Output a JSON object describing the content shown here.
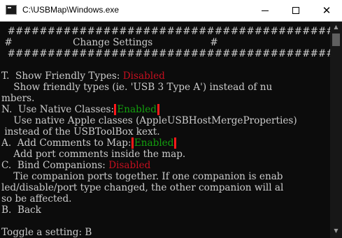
{
  "window": {
    "title": "C:\\USBMap\\Windows.exe",
    "minimize_glyph": "",
    "close_glyph": "✕"
  },
  "console": {
    "lines": [
      "  #######################################################",
      " #                    Change Settings                   #",
      "  #######################################################",
      "",
      "T.  Show Friendly Types: ",
      "    Show friendly types (ie. 'USB 3 Type A') instead of nu",
      "mbers.",
      "N.  Use Native Classes: ",
      "    Use native Apple classes (AppleUSBHostMergeProperties)",
      " instead of the USBToolBox kext.",
      "A.  Add Comments to Map: ",
      "    Add port comments inside the map.",
      "C.  Bind Companions: ",
      "    Tie companion ports together. If one companion is enab",
      "led/disable/port type changed, the other companion will al",
      "so be affected.",
      "B.  Back",
      "",
      "Toggle a setting: B"
    ],
    "settings": {
      "friendly_types": "Disabled",
      "native_classes": "Enabled",
      "comments": "Enabled",
      "bind_companions": "Disabled"
    }
  },
  "scrollbar": {
    "up_arrow": "▲",
    "down_arrow": "▼"
  },
  "colors": {
    "background": "#0c0c0c",
    "text": "#cccccc",
    "disabled": "#c50f1f",
    "enabled": "#13a10e",
    "highlight_box": "#ff1a1a"
  }
}
